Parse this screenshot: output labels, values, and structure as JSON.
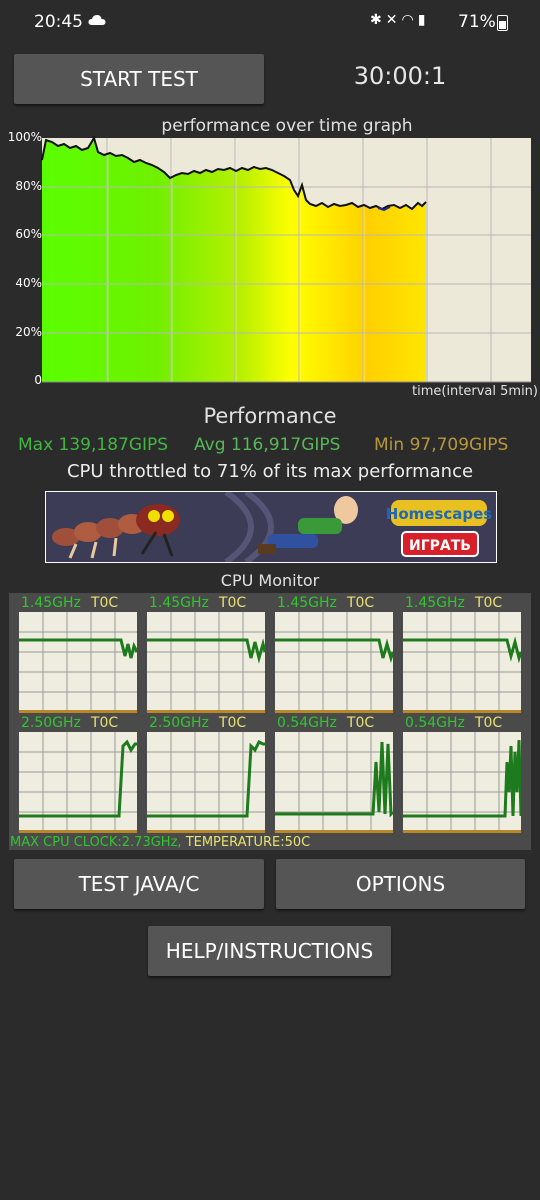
{
  "status_bar": {
    "time": "20:45",
    "battery": "71%"
  },
  "toolbar": {
    "start_label": "START TEST",
    "timer": "30:00:1"
  },
  "graph": {
    "title": "performance over time graph",
    "y_ticks": [
      "100%",
      "80%",
      "60%",
      "40%",
      "20%",
      "0"
    ],
    "x_label": "time(interval 5min)"
  },
  "performance": {
    "title": "Performance",
    "max": "Max 139,187GIPS",
    "avg": "Avg 116,917GIPS",
    "min": "Min 97,709GIPS",
    "throttle": "CPU throttled to 71% of its max performance"
  },
  "ad": {
    "brand": "Homescapes",
    "cta": "ИГРАТЬ"
  },
  "cpu_monitor": {
    "title": "CPU Monitor",
    "cores": [
      {
        "freq": "1.45GHz",
        "temp": "T0C"
      },
      {
        "freq": "1.45GHz",
        "temp": "T0C"
      },
      {
        "freq": "1.45GHz",
        "temp": "T0C"
      },
      {
        "freq": "1.45GHz",
        "temp": "T0C"
      },
      {
        "freq": "2.50GHz",
        "temp": "T0C"
      },
      {
        "freq": "2.50GHz",
        "temp": "T0C"
      },
      {
        "freq": "0.54GHz",
        "temp": "T0C"
      },
      {
        "freq": "0.54GHz",
        "temp": "T0C"
      }
    ],
    "max_clock": "MAX CPU CLOCK:2.73GHz,",
    "temperature": "TEMPERATURE:50C"
  },
  "buttons": {
    "test_java": "TEST JAVA/C",
    "options": "OPTIONS",
    "help": "HELP/INSTRUCTIONS"
  },
  "colors": {
    "background": "#2b2b2b",
    "button": "#555555",
    "stat_max": "#3fb83f",
    "stat_avg": "#56b856",
    "stat_min": "#b8973a",
    "core_freq": "#2fc62f",
    "core_temp": "#e8e070"
  }
}
